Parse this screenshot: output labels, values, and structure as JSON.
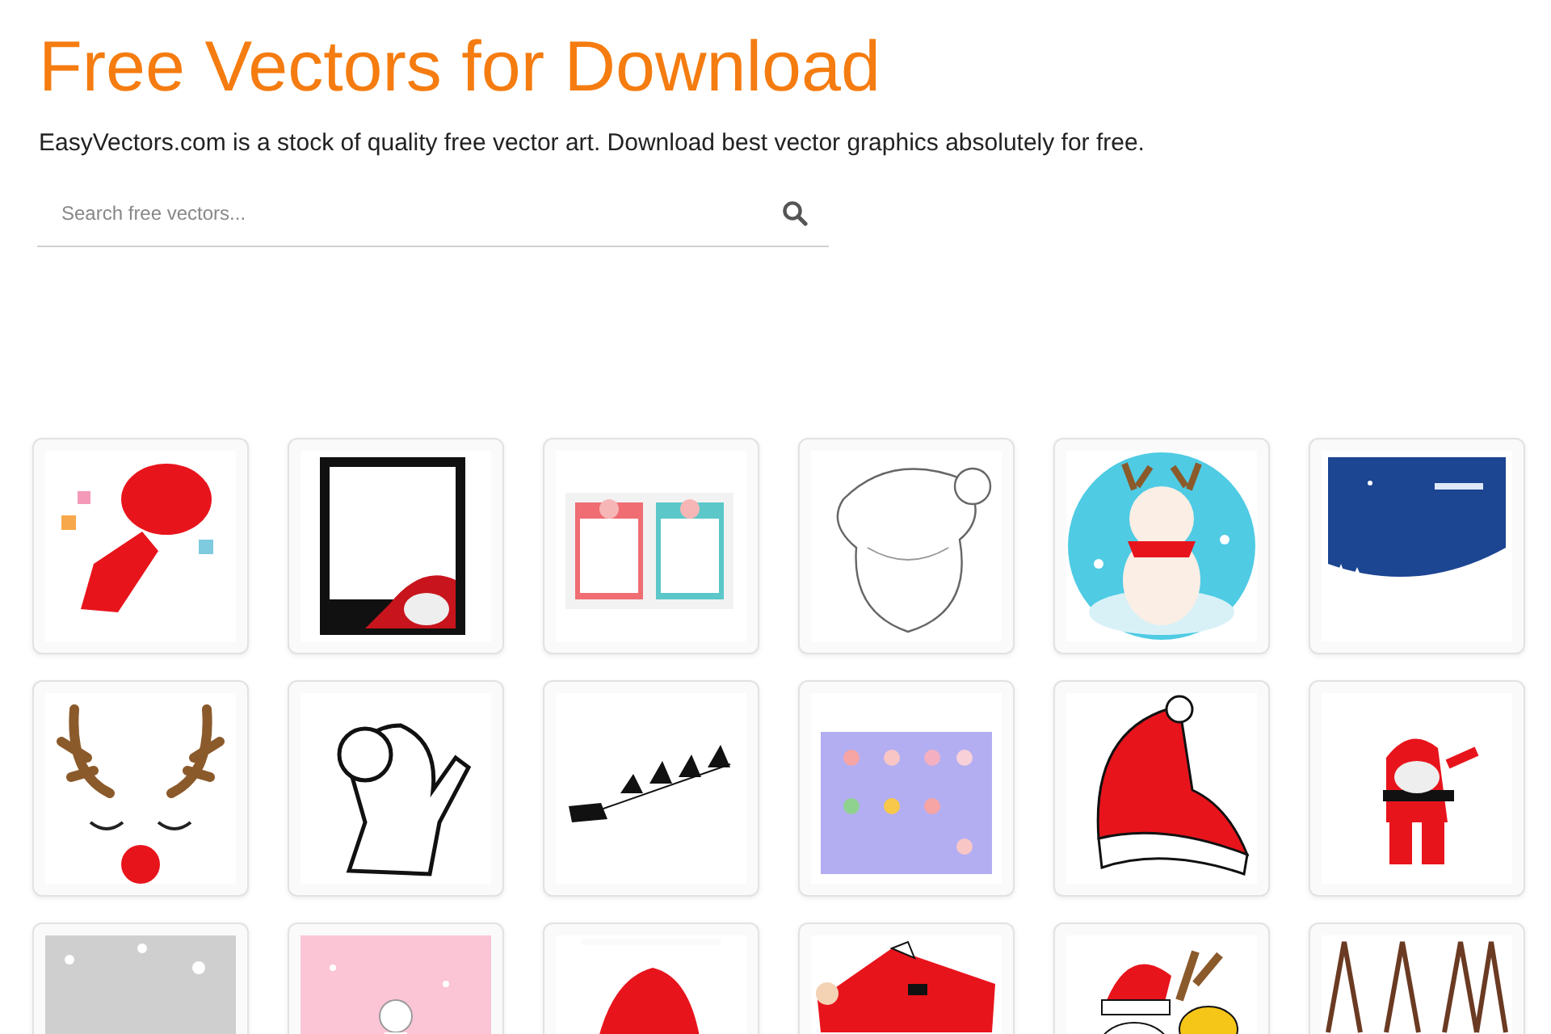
{
  "header": {
    "title": "Free Vectors for Download",
    "tagline": "EasyVectors.com is a stock of quality free vector art. Download best vector graphics absolutely for free."
  },
  "search": {
    "placeholder": "Search free vectors..."
  }
}
